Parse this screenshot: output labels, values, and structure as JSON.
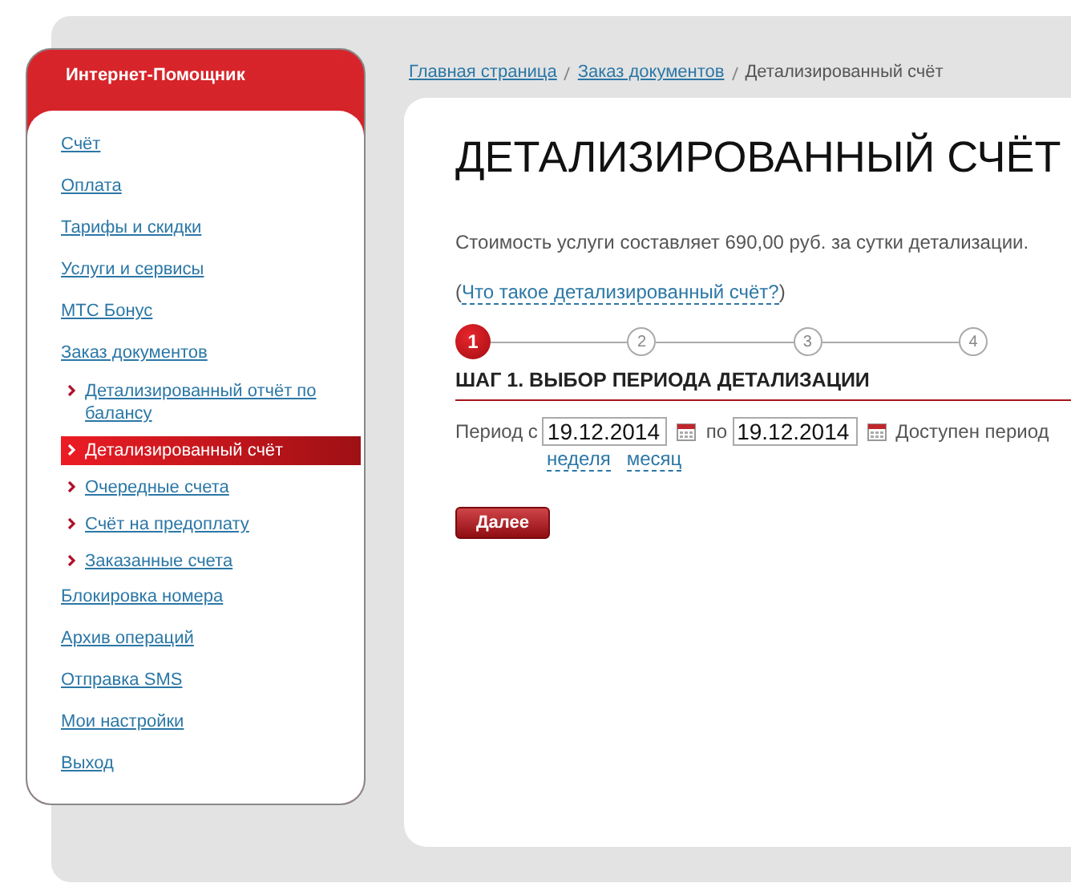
{
  "sidebar": {
    "title": "Интернет-Помощник",
    "items": [
      {
        "label": "Счёт",
        "selected": false
      },
      {
        "label": "Оплата",
        "selected": false
      },
      {
        "label": "Тарифы и скидки",
        "selected": false
      },
      {
        "label": "Услуги и сервисы",
        "selected": false
      },
      {
        "label": "МТС Бонус",
        "selected": false
      },
      {
        "label": "Заказ документов",
        "selected": false,
        "children": [
          {
            "label": "Детализированный отчёт по балансу",
            "selected": false
          },
          {
            "label": "Детализированный счёт",
            "selected": true
          },
          {
            "label": "Очередные счета",
            "selected": false
          },
          {
            "label": "Счёт на предоплату",
            "selected": false
          },
          {
            "label": "Заказанные счета",
            "selected": false
          }
        ]
      },
      {
        "label": "Блокировка номера",
        "selected": false
      },
      {
        "label": "Архив операций",
        "selected": false
      },
      {
        "label": "Отправка SMS",
        "selected": false
      },
      {
        "label": "Мои настройки",
        "selected": false
      },
      {
        "label": "Выход",
        "selected": false
      }
    ]
  },
  "breadcrumb": {
    "links": [
      "Главная страница",
      "Заказ документов"
    ],
    "current": "Детализированный счёт"
  },
  "page": {
    "title": "ДЕТАЛИЗИРОВАННЫЙ СЧЁТ",
    "price_note": "Стоимость услуги составляет 690,00 руб. за сутки детализации.",
    "help_link_open": "(",
    "help_link": "Что такое детализированный счёт?",
    "help_link_close": ")"
  },
  "steps": [
    {
      "label": "1",
      "selected": true
    },
    {
      "label": "2",
      "selected": false
    },
    {
      "label": "3",
      "selected": false
    },
    {
      "label": "4",
      "selected": false
    }
  ],
  "step_heading": "ШАГ 1. ВЫБОР ПЕРИОДА ДЕТАЛИЗАЦИИ",
  "form": {
    "from_label": "Период с",
    "from_value": "19.12.2014",
    "to_label": "по",
    "to_value": "19.12.2014",
    "available_note": "Доступен период",
    "quick_links": [
      "неделя",
      "месяц"
    ]
  },
  "button": "Далее"
}
